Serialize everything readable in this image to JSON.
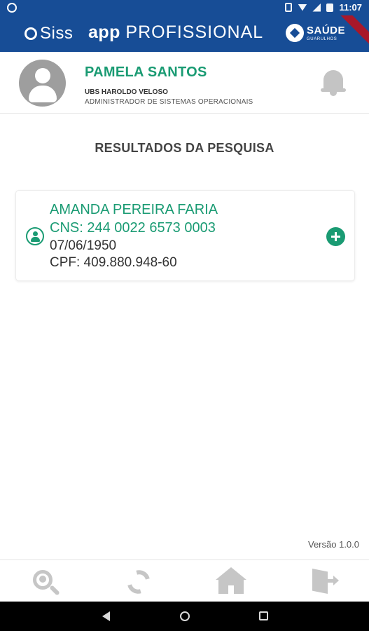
{
  "status_bar": {
    "time": "11:07"
  },
  "header": {
    "brand": "Siss",
    "app_word": "app",
    "app_suffix": "PROFISSIONAL",
    "partner_main": "SAÚDE",
    "partner_sub": "GUARULHOS"
  },
  "profile": {
    "name": "PAMELA SANTOS",
    "unit": "UBS HAROLDO VELOSO",
    "role": "ADMINISTRADOR DE SISTEMAS OPERACIONAIS"
  },
  "results": {
    "title": "RESULTADOS DA PESQUISA",
    "items": [
      {
        "name": "AMANDA PEREIRA FARIA",
        "cns": "CNS: 244 0022 6573 0003",
        "birth_date": "07/06/1950",
        "cpf": "CPF: 409.880.948-60"
      }
    ]
  },
  "footer": {
    "version": "Versão 1.0.0"
  },
  "colors": {
    "primary": "#174d96",
    "accent": "#1a9b73",
    "icon_gray": "#c6c6c6"
  }
}
